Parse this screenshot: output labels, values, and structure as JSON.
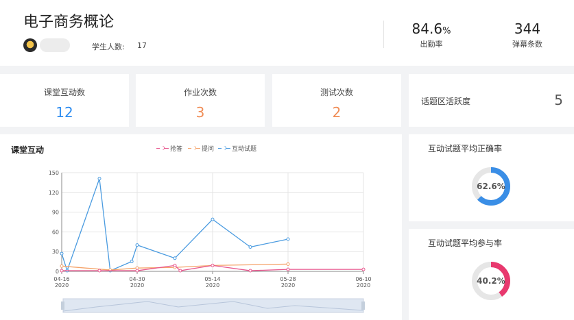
{
  "header": {
    "course_title": "电子商务概论",
    "students_label": "学生人数:",
    "students_value": "17",
    "attendance": {
      "value": "84.6",
      "unit": "%",
      "label": "出勤率"
    },
    "danmaku": {
      "value": "344",
      "label": "弹幕条数"
    }
  },
  "counts": [
    {
      "label": "课堂互动数",
      "value": "12",
      "color": "#2d8cf0"
    },
    {
      "label": "作业次数",
      "value": "3",
      "color": "#f08c55"
    },
    {
      "label": "测试次数",
      "value": "2",
      "color": "#f08c55"
    }
  ],
  "topic": {
    "label": "话题区活跃度",
    "value": "5"
  },
  "chart": {
    "title": "课堂互动",
    "legend": [
      {
        "name": "抢答",
        "color": "#e8578e"
      },
      {
        "name": "提问",
        "color": "#f5a36a"
      },
      {
        "name": "互动试题",
        "color": "#4a9be0"
      }
    ]
  },
  "chart_data": {
    "type": "line",
    "title": "课堂互动",
    "ylim": [
      0,
      150
    ],
    "yticks": [
      0,
      30,
      60,
      90,
      120,
      150
    ],
    "xlim": [
      0,
      56
    ],
    "x_ticks": [
      {
        "x": 0,
        "date": "04-16",
        "year": "2020"
      },
      {
        "x": 14,
        "date": "04-30",
        "year": "2020"
      },
      {
        "x": 28,
        "date": "05-14",
        "year": "2020"
      },
      {
        "x": 42,
        "date": "05-28",
        "year": "2020"
      },
      {
        "x": 56,
        "date": "06-10",
        "year": "2020"
      }
    ],
    "series": [
      {
        "name": "互动试题",
        "color": "#4a9be0",
        "points": [
          [
            0,
            27
          ],
          [
            1,
            1
          ],
          [
            7,
            141
          ],
          [
            9,
            1
          ],
          [
            13,
            15
          ],
          [
            14,
            40
          ],
          [
            21,
            20
          ],
          [
            28,
            79
          ],
          [
            35,
            37
          ],
          [
            42,
            49
          ]
        ]
      },
      {
        "name": "提问",
        "color": "#f5a36a",
        "points": [
          [
            0,
            8
          ],
          [
            9,
            2
          ],
          [
            14,
            5
          ],
          [
            21,
            6
          ],
          [
            28,
            9
          ],
          [
            42,
            11
          ]
        ]
      },
      {
        "name": "抢答",
        "color": "#e8578e",
        "points": [
          [
            0,
            1
          ],
          [
            7,
            1
          ],
          [
            14,
            1
          ],
          [
            21,
            9
          ],
          [
            22,
            1
          ],
          [
            28,
            9
          ],
          [
            35,
            1
          ],
          [
            42,
            3
          ],
          [
            56,
            3
          ]
        ]
      }
    ]
  },
  "donuts": [
    {
      "title": "互动试题平均正确率",
      "value": 62.6,
      "label": "62.6%",
      "color": "#3a8ee6"
    },
    {
      "title": "互动试题平均参与率",
      "value": 40.2,
      "label": "40.2%",
      "color": "#e8386e"
    }
  ]
}
